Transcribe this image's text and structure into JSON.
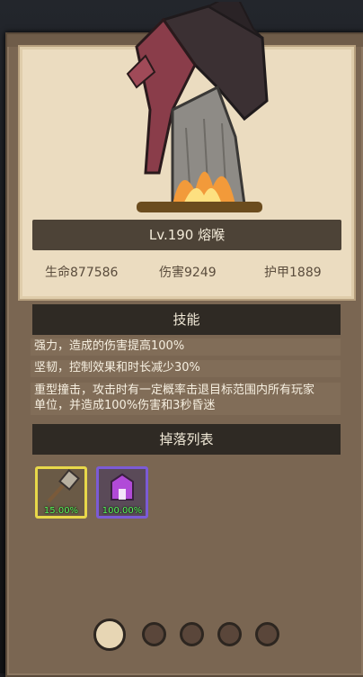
{
  "boss": {
    "name": "Lv.190 熔喉",
    "stats": {
      "hp": "生命877586",
      "damage": "伤害9249",
      "armor": "护甲1889"
    }
  },
  "skills_section": {
    "title": "技能",
    "items": [
      "强力，造成的伤害提高100%",
      "坚韧，控制效果和时长减少30%",
      "重型撞击，攻击时有一定概率击退目标范围内所有玩家",
      "单位，并造成100%伤害和3秒昏迷"
    ]
  },
  "drops_section": {
    "title": "掉落列表",
    "items": [
      {
        "icon": "hammer-icon",
        "rate": "15.00%",
        "rarity_color": "#e8d84a"
      },
      {
        "icon": "purple-armor-icon",
        "rate": "100.00%",
        "rarity_color": "#7b5bd6"
      }
    ]
  },
  "pagination": {
    "pages": 5,
    "active": 1
  },
  "colors": {
    "panel": "#7a6652",
    "card": "#ebdcc0",
    "header_bar": "#2f2a24",
    "rate_text": "#5eff5e"
  }
}
